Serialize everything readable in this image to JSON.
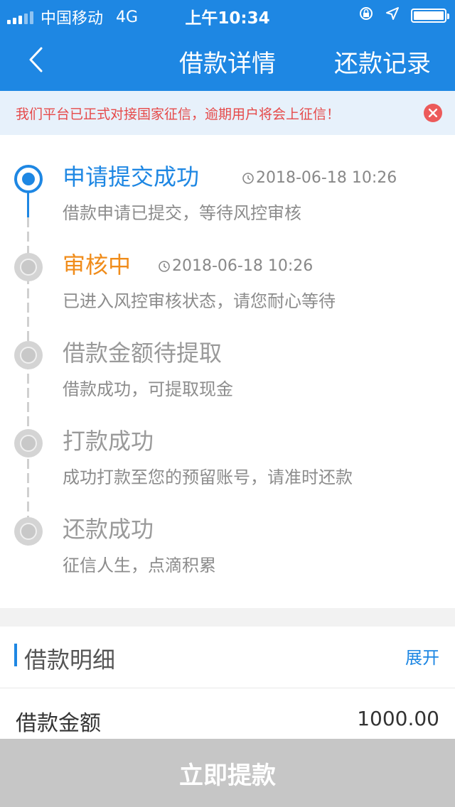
{
  "status_bar": {
    "carrier": "中国移动",
    "network": "4G",
    "time": "上午10:34"
  },
  "nav": {
    "title": "借款详情",
    "right_link": "还款记录"
  },
  "notice": {
    "text": "我们平台已正式对接国家征信，逾期用户将会上征信！"
  },
  "steps": [
    {
      "name": "申请提交成功",
      "time": "2018-06-18 10:26",
      "desc": "借款申请已提交，等待风控审核",
      "state": "done",
      "color": "#1e87e3"
    },
    {
      "name": "审核中",
      "time": "2018-06-18 10:26",
      "desc": "已进入风控审核状态，请您耐心等待",
      "state": "current",
      "color": "#f08c1a"
    },
    {
      "name": "借款金额待提取",
      "time": "",
      "desc": "借款成功，可提取现金",
      "state": "pending",
      "color": "#9a9a9a"
    },
    {
      "name": "打款成功",
      "time": "",
      "desc": "成功打款至您的预留账号，请准时还款",
      "state": "pending",
      "color": "#9a9a9a"
    },
    {
      "name": "还款成功",
      "time": "",
      "desc": "征信人生，点滴积累",
      "state": "pending",
      "color": "#9a9a9a"
    }
  ],
  "detail": {
    "title": "借款明细",
    "expand": "展开",
    "amount_label": "借款金额",
    "amount_value": "1000.00"
  },
  "submit_label": "立即提款",
  "colors": {
    "primary": "#1e87e3",
    "warning": "#f08c1a",
    "notice_text": "#e64a4a",
    "disabled_button": "#c6c6c6"
  }
}
